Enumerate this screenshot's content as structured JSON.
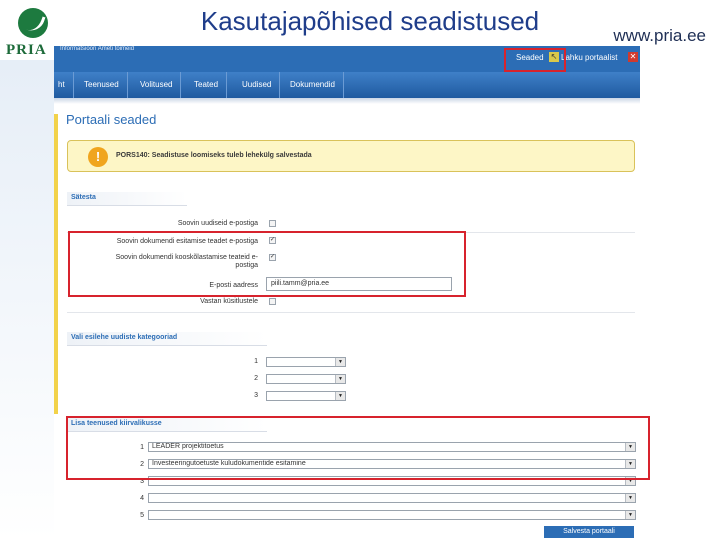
{
  "slide": {
    "title": "Kasutajapõhised seadistused",
    "url": "www.pria.ee",
    "logo_text": "PRIA"
  },
  "topbar": {
    "tagline": "Informatsioon Ameti toimeid",
    "settings_link": "Seaded",
    "leave_link": "Lahku portaalist"
  },
  "nav": {
    "items": [
      "ht",
      "Teenused",
      "Volitused",
      "Teated",
      "Uudised",
      "Dokumendid"
    ]
  },
  "page": {
    "title": "Portaali seaded",
    "alert": "PORS140: Seadistuse loomiseks tuleb lehekülg salvestada"
  },
  "notifications": {
    "heading": "Sätesta",
    "news_email": {
      "label": "Soovin uudiseid e-postiga",
      "checked": false
    },
    "doc_submit_email": {
      "label": "Soovin dokumendi esitamise teadet e-postiga",
      "checked": true
    },
    "doc_approve_email": {
      "label": "Soovin dokumendi kooskõlastamise teateid e-postiga",
      "checked": true
    },
    "email_address": {
      "label": "E-posti aadress",
      "value": "piili.tamm@pria.ee"
    },
    "answer_survey": {
      "label": "Vastan küsitlustele",
      "checked": false
    }
  },
  "categories": {
    "heading": "Vali esilehe uudiste kategooriad",
    "rows": [
      {
        "num": "1",
        "value": ""
      },
      {
        "num": "2",
        "value": ""
      },
      {
        "num": "3",
        "value": ""
      }
    ]
  },
  "quick_services": {
    "heading": "Lisa teenused kiirvalikusse",
    "rows": [
      {
        "num": "1",
        "value": "LEADER projektitoetus"
      },
      {
        "num": "2",
        "value": "Investeeringutoetuste kuludokumentide esitamine"
      },
      {
        "num": "3",
        "value": ""
      },
      {
        "num": "4",
        "value": ""
      },
      {
        "num": "5",
        "value": ""
      }
    ]
  },
  "save_button": "Salvesta portaali",
  "icons": {
    "arrow": "back-arrow-icon",
    "close": "close-icon",
    "alert": "warning-icon",
    "caret": "chevron-down-icon"
  },
  "colors": {
    "brand_blue": "#2c6db5",
    "highlight_red": "#d7232d",
    "alert_bg": "#fdf6c6",
    "logo_green": "#1d7a3f"
  }
}
